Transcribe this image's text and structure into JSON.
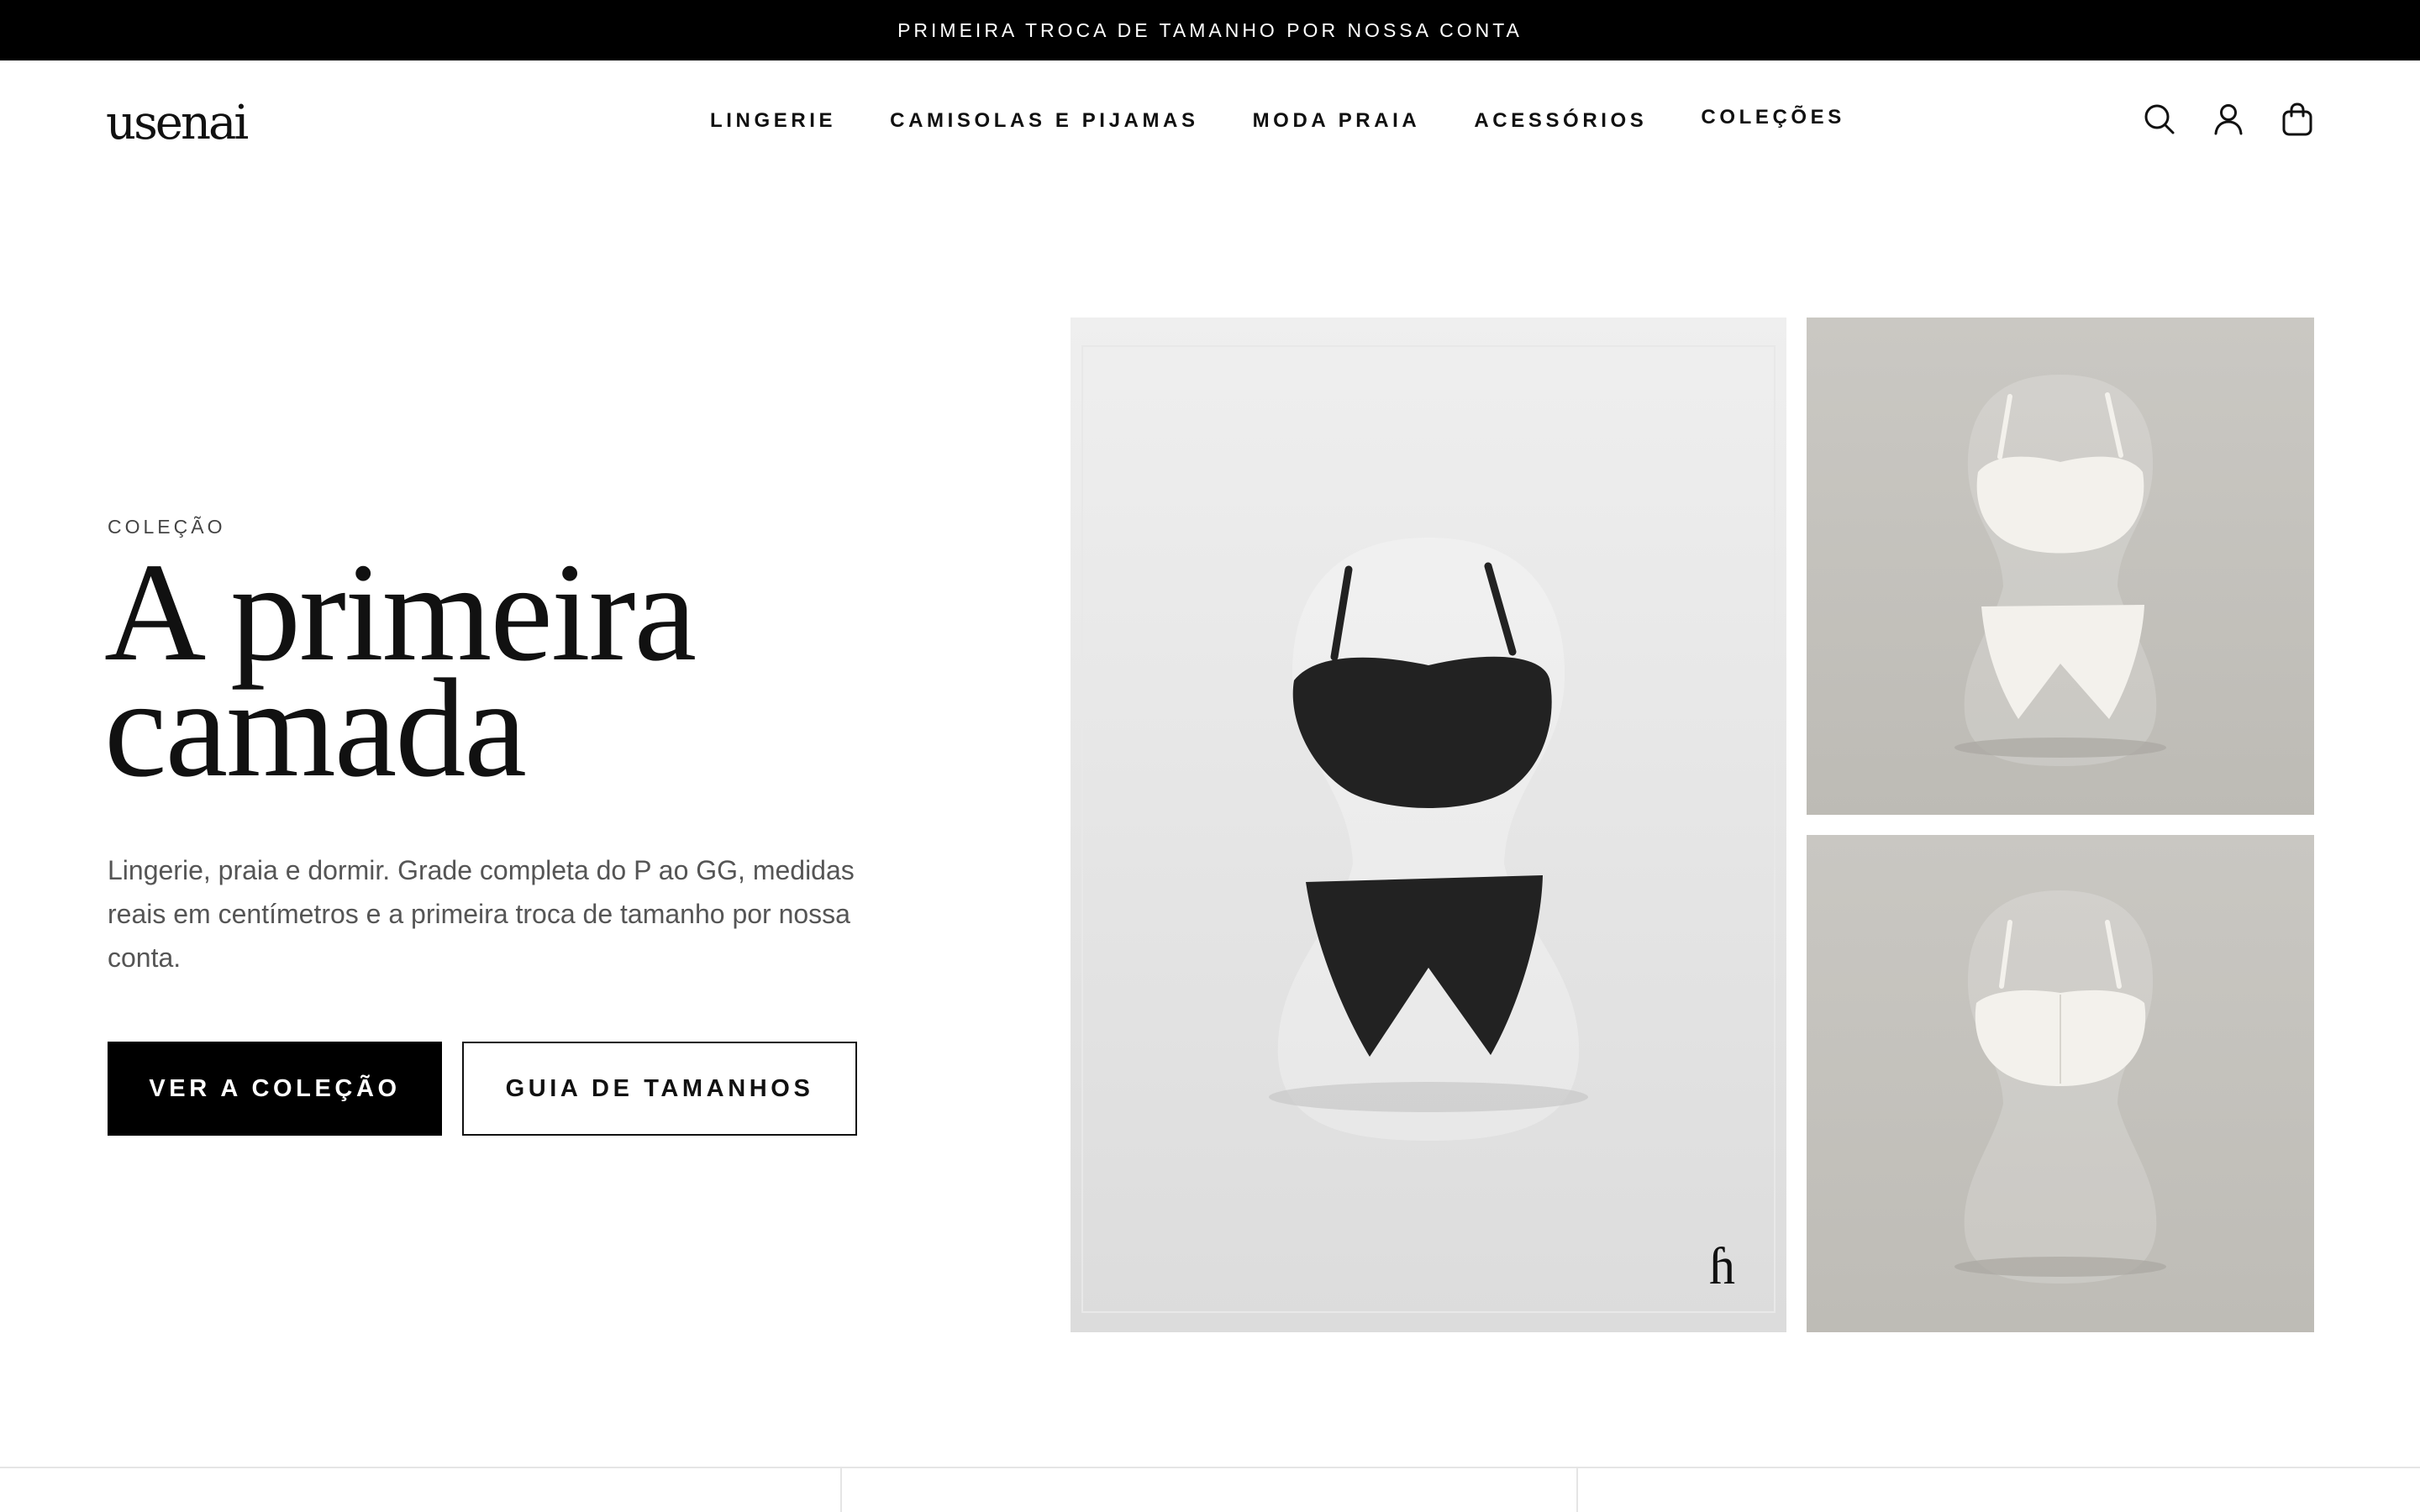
{
  "announcement": "PRIMEIRA TROCA DE TAMANHO POR NOSSA CONTA",
  "brand": {
    "logo_text": "usenai"
  },
  "nav": {
    "items": [
      "LINGERIE",
      "CAMISOLAS E PIJAMAS",
      "MODA PRAIA",
      "ACESSÓRIOS",
      "COLEÇÕES"
    ]
  },
  "header_icons": [
    "search-icon",
    "account-icon",
    "cart-icon"
  ],
  "hero": {
    "eyebrow": "COLEÇÃO",
    "headline_line1": "A primeira",
    "headline_line2": "camada",
    "description": "Lingerie, praia e dormir. Grade completa do P ao GG, medidas reais em centímetros e a primeira troca de tamanho por nossa conta.",
    "primary_cta": "VER A COLEÇÃO",
    "secondary_cta": "GUIA DE TAMANHOS"
  },
  "images": {
    "main": {
      "garment_color": "#222222",
      "background": "#e4e4e4"
    },
    "top": {
      "garment_color": "#f3f1ec",
      "background": "#c2c0bb"
    },
    "bottom": {
      "garment_color": "#f3f1ec",
      "background": "#c2c0bb"
    }
  },
  "colors": {
    "announcement_bg": "#000000",
    "primary_button_bg": "#000000",
    "text": "#111111",
    "muted_text": "#555555"
  }
}
